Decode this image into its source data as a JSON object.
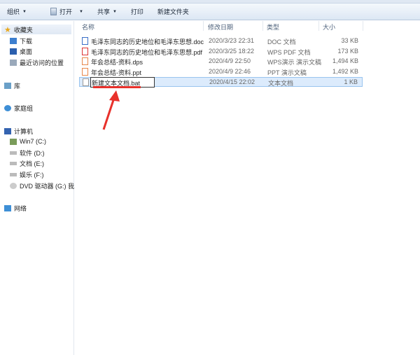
{
  "toolbar": {
    "organize": "组织",
    "open": "打开",
    "share": "共享",
    "print": "打印",
    "new_folder": "新建文件夹"
  },
  "sidebar": {
    "favorites": "收藏夹",
    "downloads": "下载",
    "desktop": "桌面",
    "recent": "最近访问的位置",
    "libraries": "库",
    "homegroup": "家庭组",
    "computer": "计算机",
    "drives": [
      "Win7 (C:)",
      "软件 (D:)",
      "文档 (E:)",
      "娱乐 (F:)",
      "DVD 驱动器 (G:) 我"
    ],
    "network": "网络"
  },
  "columns": {
    "name": "名称",
    "date": "修改日期",
    "type": "类型",
    "size": "大小"
  },
  "files": [
    {
      "name": "毛泽东同志的历史地位和毛泽东思想.doc",
      "date": "2020/3/23 22:31",
      "type": "DOC 文档",
      "size": "33 KB",
      "color": "#3a6fc7"
    },
    {
      "name": "毛泽东同志的历史地位和毛泽东思想.pdf",
      "date": "2020/3/25 18:22",
      "type": "WPS PDF 文档",
      "size": "173 KB",
      "color": "#d33"
    },
    {
      "name": "年会总结-资料.dps",
      "date": "2020/4/9 22:50",
      "type": "WPS演示 演示文稿",
      "size": "1,494 KB",
      "color": "#e8874a"
    },
    {
      "name": "年会总结-资料.ppt",
      "date": "2020/4/9 22:46",
      "type": "PPT 演示文稿",
      "size": "1,492 KB",
      "color": "#e8874a"
    },
    {
      "name": "新建文本文档.bat",
      "date": "2020/4/15 22:02",
      "type": "文本文档",
      "size": "1 KB",
      "color": "#999"
    }
  ]
}
